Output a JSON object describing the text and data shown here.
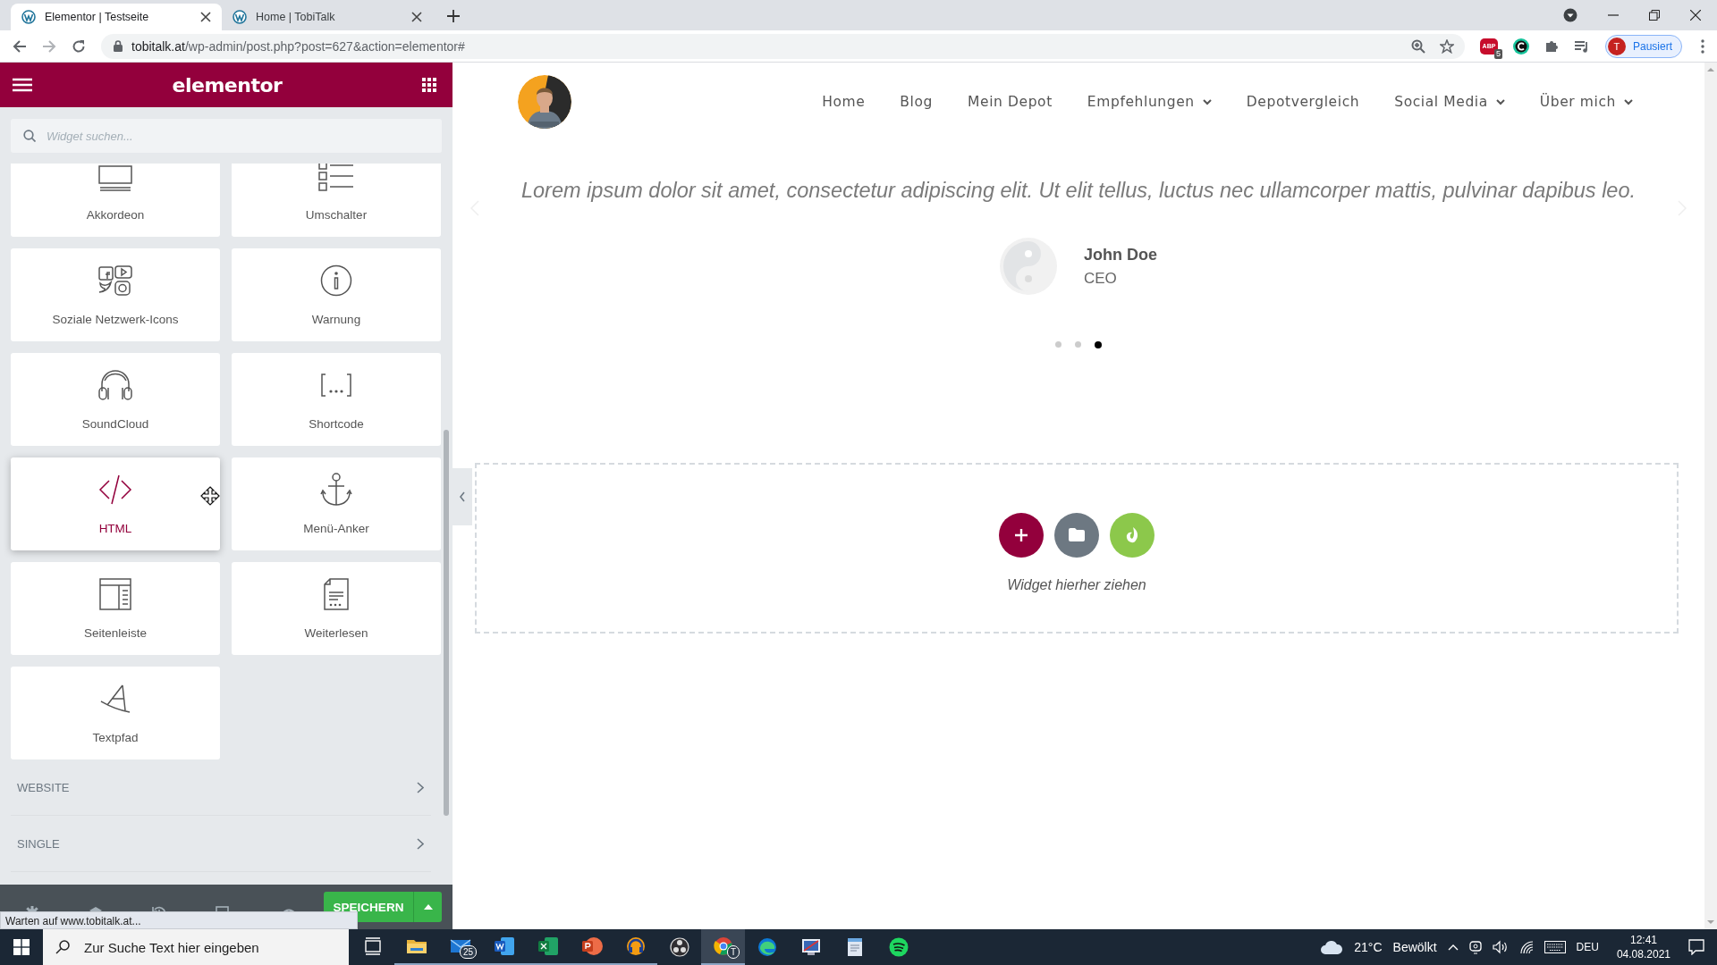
{
  "browser": {
    "tabs": [
      {
        "title": "Elementor | Testseite",
        "selected": true
      },
      {
        "title": "Home | TobiTalk",
        "selected": false
      }
    ],
    "url": {
      "host": "tobitalk.at",
      "path": "/wp-admin/post.php?post=627&action=elementor#"
    },
    "extensions": [
      {
        "kind": "adblock",
        "label": "ABP",
        "badge": "5"
      },
      {
        "kind": "grammar"
      },
      {
        "kind": "puzzle"
      },
      {
        "kind": "media"
      }
    ],
    "profile": {
      "initial": "T",
      "label": "Pausiert"
    }
  },
  "editor": {
    "logo": "elementor",
    "search": {
      "placeholder": "Widget suchen..."
    },
    "widgets": [
      {
        "label": "Akkordeon",
        "kind": "accordion",
        "selected": false
      },
      {
        "label": "Umschalter",
        "kind": "toggle",
        "selected": false
      },
      {
        "label": "Soziale Netzwerk-Icons",
        "kind": "social",
        "selected": false
      },
      {
        "label": "Warnung",
        "kind": "alert",
        "selected": false
      },
      {
        "label": "SoundCloud",
        "kind": "soundcloud",
        "selected": false
      },
      {
        "label": "Shortcode",
        "kind": "shortcode",
        "selected": false
      },
      {
        "label": "HTML",
        "kind": "html",
        "selected": true
      },
      {
        "label": "Menü-Anker",
        "kind": "anchor",
        "selected": false
      },
      {
        "label": "Seitenleiste",
        "kind": "sidebar",
        "selected": false
      },
      {
        "label": "Weiterlesen",
        "kind": "readmore",
        "selected": false
      },
      {
        "label": "Textpfad",
        "kind": "textpath",
        "selected": false
      }
    ],
    "categories": [
      {
        "label": "WEBSITE"
      },
      {
        "label": "SINGLE"
      }
    ],
    "save_button": "SPEICHERN"
  },
  "status_text": "Warten auf www.tobitalk.at...",
  "page": {
    "nav": [
      {
        "label": "Home",
        "dropdown": false
      },
      {
        "label": "Blog",
        "dropdown": false
      },
      {
        "label": "Mein Depot",
        "dropdown": false
      },
      {
        "label": "Empfehlungen",
        "dropdown": true
      },
      {
        "label": "Depotvergleich",
        "dropdown": false
      },
      {
        "label": "Social Media",
        "dropdown": true
      },
      {
        "label": "Über mich",
        "dropdown": true
      }
    ],
    "testimonial": {
      "quote": "Lorem ipsum dolor sit amet, consectetur adipiscing elit. Ut elit tellus, luctus nec ullamcorper mattis, pulvinar dapibus leo.",
      "name": "John Doe",
      "title": "CEO"
    },
    "dots": [
      {
        "selected": false
      },
      {
        "selected": false
      },
      {
        "selected": true
      }
    ],
    "dropzone": {
      "hint": "Widget hierher ziehen"
    }
  },
  "taskbar": {
    "search": {
      "placeholder": "Zur Suche Text hier eingeben"
    },
    "apps": [
      {
        "kind": "taskview",
        "running": false
      },
      {
        "kind": "explorer",
        "running": true
      },
      {
        "kind": "mail",
        "running": true,
        "badge": "25"
      },
      {
        "kind": "word",
        "running": true
      },
      {
        "kind": "excel",
        "running": true
      },
      {
        "kind": "powerpoint",
        "running": true
      },
      {
        "kind": "audio",
        "running": true
      },
      {
        "kind": "obs",
        "running": false
      },
      {
        "kind": "chrome",
        "running": true,
        "badge": "T"
      },
      {
        "kind": "edge",
        "running": false
      },
      {
        "kind": "screen",
        "running": false
      },
      {
        "kind": "notepad",
        "running": false
      },
      {
        "kind": "spotify",
        "running": false
      }
    ],
    "weather": {
      "temp": "21°C",
      "text": "Bewölkt"
    },
    "language": "DEU",
    "time": "12:41",
    "date": "04.08.2021"
  }
}
